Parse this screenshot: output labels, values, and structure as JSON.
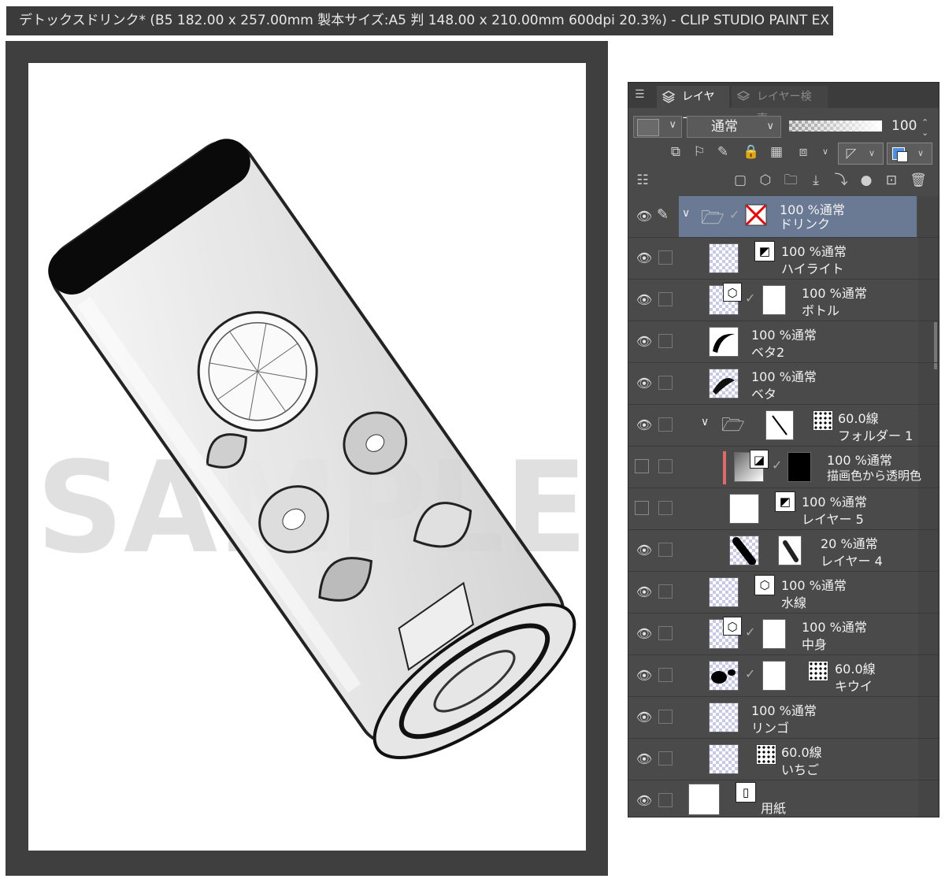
{
  "window": {
    "title": "デトックスドリンク* (B5 182.00 x 257.00mm 製本サイズ:A5 判 148.00 x 210.00mm 600dpi 20.3%)  - CLIP STUDIO PAINT EX"
  },
  "canvas": {
    "watermark": "SAMPLE"
  },
  "panel": {
    "tab_layer": "レイヤー",
    "tab_search": "レイヤー検索",
    "blend_mode": "通常",
    "opacity": "100",
    "layers": [
      {
        "opacity": "100 %通常",
        "name": "ドリンク",
        "selected": true
      },
      {
        "opacity": "100 %通常",
        "name": "ハイライト"
      },
      {
        "opacity": "100 %通常",
        "name": "ボトル"
      },
      {
        "opacity": "100 %通常",
        "name": "ベタ2"
      },
      {
        "opacity": "100 %通常",
        "name": "ベタ"
      },
      {
        "opacity": "60.0線",
        "name": "フォルダー 1"
      },
      {
        "opacity": "100 %通常",
        "name": "描画色から透明色"
      },
      {
        "opacity": "100 %通常",
        "name": "レイヤー 5"
      },
      {
        "opacity": "20 %通常",
        "name": "レイヤー 4"
      },
      {
        "opacity": "100 %通常",
        "name": "水線"
      },
      {
        "opacity": "100 %通常",
        "name": "中身"
      },
      {
        "opacity": "60.0線",
        "name": "キウイ"
      },
      {
        "opacity": "100 %通常",
        "name": "リンゴ"
      },
      {
        "opacity": "60.0線",
        "name": "いちご"
      },
      {
        "opacity": "",
        "name": "用紙"
      }
    ]
  },
  "colors": {
    "accent_selected_row": "#6a7a94",
    "panel_bg": "#4a4a4a",
    "canvas_bg": "#3f3f3f",
    "titlebar_bg": "#3b3b3b"
  },
  "icons": [
    "menu-icon",
    "layers-icon",
    "layer-search-icon",
    "eye-icon",
    "pen-icon",
    "folder-icon",
    "check-icon",
    "trash-icon",
    "new-layer-icon",
    "mask-icon"
  ]
}
